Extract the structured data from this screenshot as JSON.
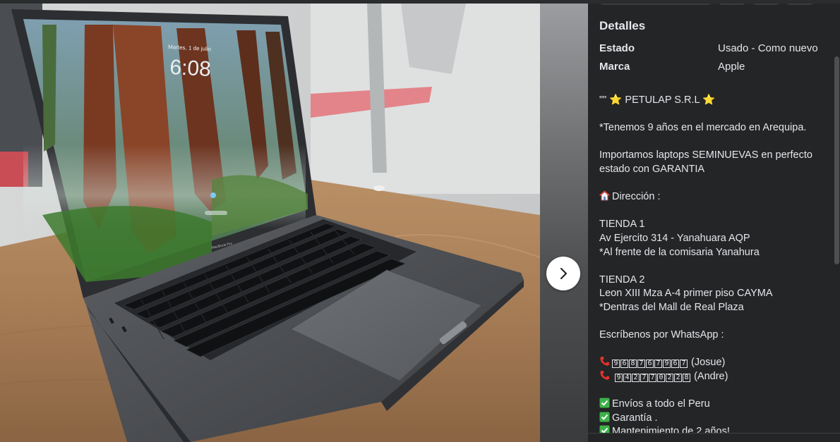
{
  "viewer": {
    "next_button_label": "Siguiente",
    "next_icon": "chevron-right-icon",
    "photo": {
      "screen_time": "6:08",
      "screen_date": "Martes, 1 de julio",
      "laptop_model_label": "MacBook Pro"
    }
  },
  "details": {
    "heading": "Detalles",
    "attributes": [
      {
        "label": "Estado",
        "value": "Usado - Como nuevo"
      },
      {
        "label": "Marca",
        "value": "Apple"
      }
    ]
  },
  "description": {
    "company_line": "\"\" ⭐ PETULAP S.R.L ⭐",
    "years_line": "*Tenemos 9 años en el mercado en Arequipa.",
    "import_line_1": "Importamos laptops SEMINUEVAS en perfecto",
    "import_line_2": "estado con GARANTIA",
    "address_label": "Dirección :",
    "store1_title": "TIENDA  1",
    "store1_address": "Av Ejercito 314 - Yanahuara AQP",
    "store1_reference": "*Al frente de la comisaria Yanahura",
    "store2_title": "TIENDA   2",
    "store2_address": "Leon XIII Mza  A-4 primer piso  CAYMA",
    "store2_reference": "*Dentras del Mall de Real Plaza",
    "whatsapp_line": "Escríbenos por WhatsApp :",
    "phones": [
      {
        "number": "968767967",
        "name": "(Josue)"
      },
      {
        "number": "942770228",
        "name": "(Andre)"
      }
    ],
    "benefits": [
      "Envíos a todo el Peru",
      "Garantía .",
      "Mantenimiento de 2 años!"
    ]
  },
  "icons": {
    "star": "star-icon",
    "house": "house-icon",
    "phone": "telephone-receiver-icon",
    "check": "check-mark-button-icon"
  },
  "colors": {
    "panel_bg": "#242526",
    "text": "#e4e6eb",
    "phone_red": "#e5322d",
    "check_green": "#3eb24a"
  }
}
